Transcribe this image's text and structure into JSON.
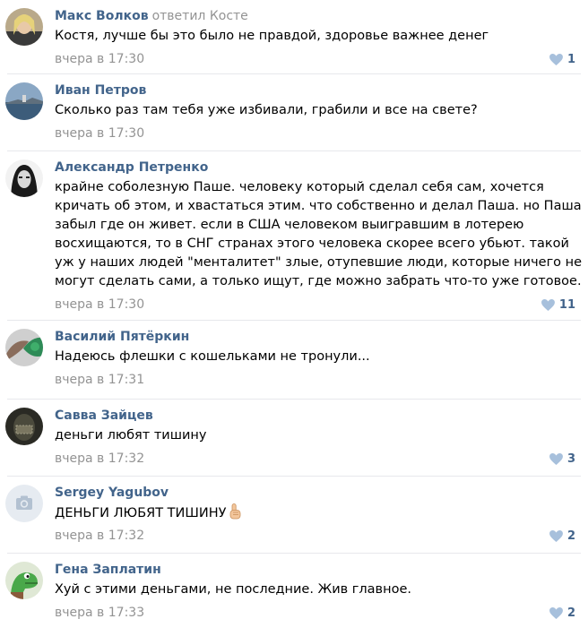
{
  "colors": {
    "author": "#42648b",
    "meta": "#939393",
    "separator": "#e7e8ec",
    "heart": "#a7c0dc",
    "likes": "#42648b"
  },
  "comments": [
    {
      "author": "Макс Волков",
      "reply_label": "ответил",
      "reply_to": "Косте",
      "text": [
        "Костя, лучше бы это было не правдой, здоровье важнее денег"
      ],
      "time": "вчера в 17:30",
      "likes": "1",
      "avatar_icon": "user-photo"
    },
    {
      "author": "Иван Петров",
      "text": [
        "Сколько раз там тебя уже избивали, грабили и все на свете?"
      ],
      "time": "вчера в 17:30",
      "likes": "",
      "avatar_icon": "landscape-photo"
    },
    {
      "author": "Александр Петренко",
      "text": [
        "крайне соболезную Паше. человеку который сделал себя сам, хочется",
        "кричать об этом, и хвастаться этим. что собственно и делал Паша. но Паша",
        "забыл где он живет. если в США человеком выигравшим в лотерею",
        "восхищаются, то в СНГ странах этого человека скорее всего убьют. такой",
        "уж у наших людей \"менталитет\" злые, отупевшие люди, которые ничего не",
        "могут сделать сами, а только ищут, где можно забрать что-то уже готовое."
      ],
      "time": "вчера в 17:30",
      "likes": "11",
      "avatar_icon": "user-photo"
    },
    {
      "author": "Василий Пятёркин",
      "text": [
        "Надеюсь флешки с кошельками не тронули..."
      ],
      "time": "вчера в 17:31",
      "likes": "",
      "avatar_icon": "user-photo"
    },
    {
      "author": "Савва Зайцев",
      "text": [
        "деньги любят тишину"
      ],
      "time": "вчера в 17:32",
      "likes": "3",
      "avatar_icon": "user-photo"
    },
    {
      "author": "Sergey Yagubov",
      "text": [
        "ДЕНЬГИ ЛЮБЯТ ТИШИНУ"
      ],
      "text_emoji": "index-finger-up-icon",
      "time": "вчера в 17:32",
      "likes": "2",
      "avatar_icon": "camera-icon"
    },
    {
      "author": "Гена Заплатин",
      "text": [
        "Хуй с этими деньгами, не последние. Жив главное."
      ],
      "time": "вчера в 17:33",
      "likes": "2",
      "avatar_icon": "crocodile-photo"
    }
  ]
}
